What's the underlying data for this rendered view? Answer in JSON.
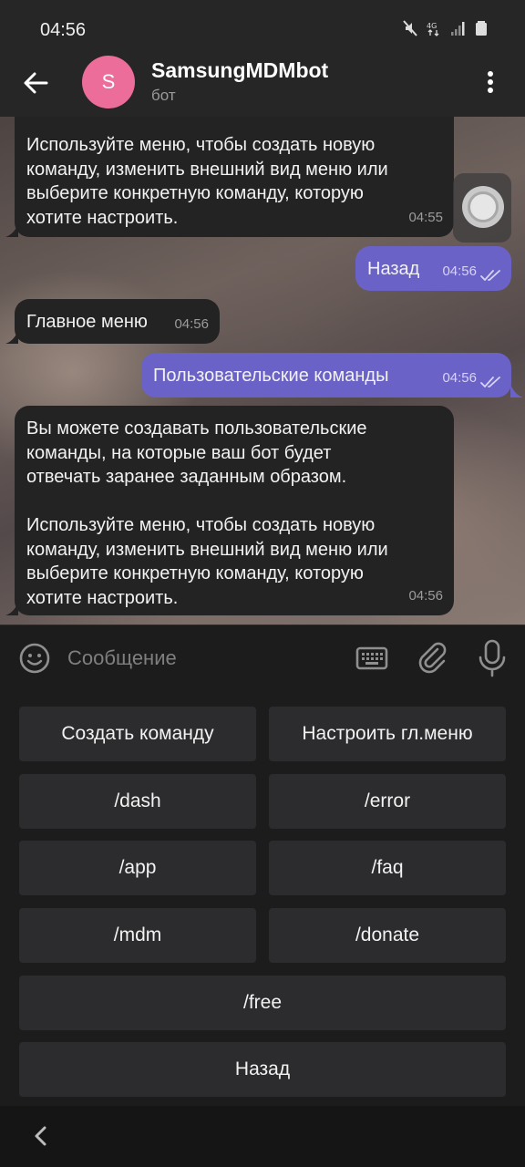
{
  "status": {
    "time": "04:56"
  },
  "header": {
    "avatar_letter": "S",
    "title": "SamsungMDMbot",
    "subtitle": "бот"
  },
  "messages": [
    {
      "dir": "in",
      "text": "Используйте меню, чтобы создать новую\nкоманду, изменить внешний вид меню или\nвыберите конкретную команду, которую\nхотите настроить.",
      "time": "04:55"
    },
    {
      "dir": "out",
      "text": "Назад",
      "time": "04:56"
    },
    {
      "dir": "in",
      "text": "Главное меню",
      "time": "04:56"
    },
    {
      "dir": "out",
      "text": "Пользовательские команды",
      "time": "04:56"
    },
    {
      "dir": "in",
      "text": "Вы можете создавать пользовательские\nкоманды, на которые ваш бот будет\nотвечать заранее заданным образом.\n\nИспользуйте меню, чтобы создать новую\nкоманду, изменить внешний вид меню или\nвыберите конкретную команду, которую\nхотите настроить.",
      "time": "04:56"
    }
  ],
  "composer": {
    "placeholder": "Сообщение"
  },
  "keyboard": {
    "rows": [
      [
        "Создать команду",
        "Настроить гл.меню"
      ],
      [
        "/dash",
        "/error"
      ],
      [
        "/app",
        "/faq"
      ],
      [
        "/mdm",
        "/donate"
      ],
      [
        "/free"
      ],
      [
        "Назад"
      ]
    ]
  },
  "colors": {
    "incoming": "#232323",
    "outgoing": "#6b62c8",
    "avatar": "#ed6d9a"
  },
  "icons": [
    "mute-icon",
    "network-4g-icon",
    "signal-icon",
    "battery-icon",
    "back-arrow-icon",
    "more-vert-icon",
    "double-check-icon",
    "emoji-icon",
    "keyboard-icon",
    "attach-icon",
    "mic-icon",
    "nav-back-icon"
  ]
}
